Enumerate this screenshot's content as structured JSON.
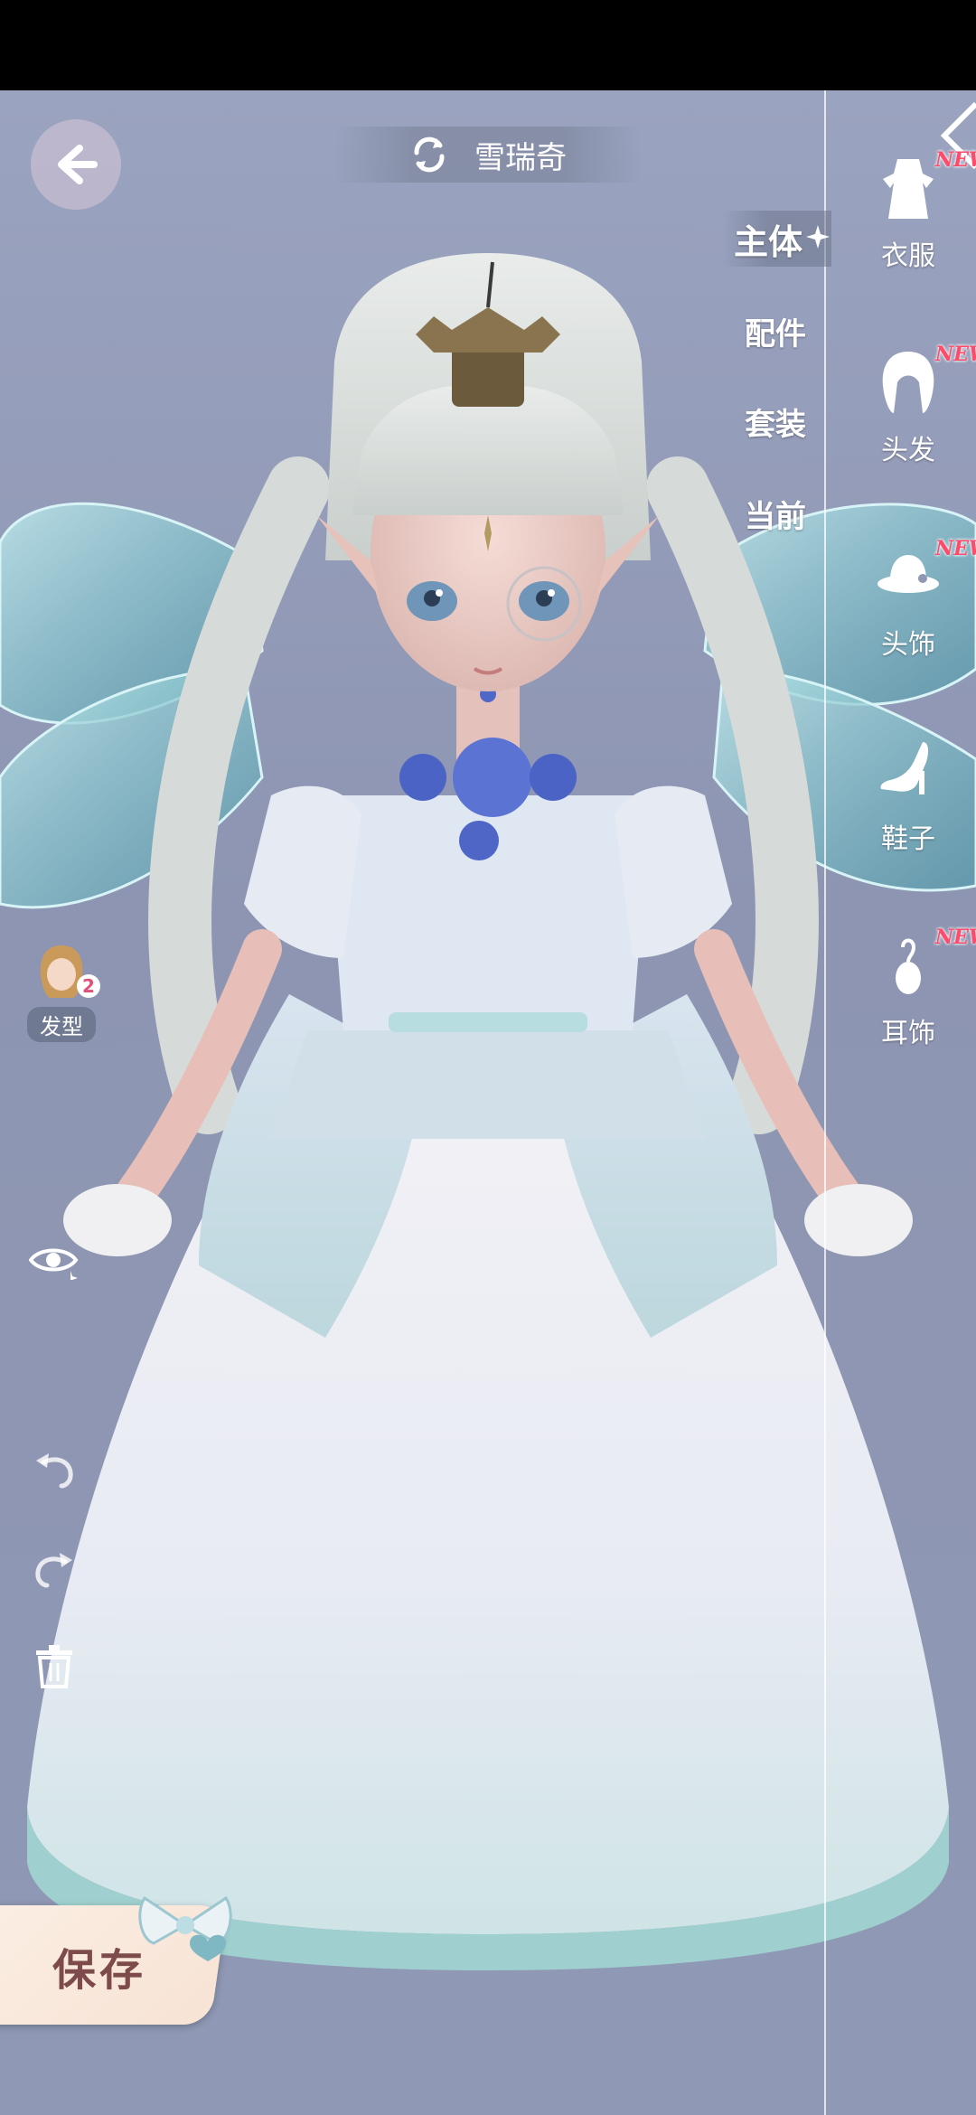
{
  "header": {
    "title": "雪瑞奇",
    "back_icon": "arrow-left-icon",
    "swap_icon": "refresh-icon"
  },
  "sub_tabs": [
    {
      "label": "主体",
      "active": true
    },
    {
      "label": "配件",
      "active": false
    },
    {
      "label": "套装",
      "active": false
    },
    {
      "label": "当前",
      "active": false
    }
  ],
  "categories": [
    {
      "label": "衣服",
      "icon": "dress-icon",
      "badge": "NEW"
    },
    {
      "label": "头发",
      "icon": "hair-icon",
      "badge": "NEW"
    },
    {
      "label": "头饰",
      "icon": "hat-icon",
      "badge": "NEW"
    },
    {
      "label": "鞋子",
      "icon": "shoe-icon",
      "badge": ""
    },
    {
      "label": "耳饰",
      "icon": "earring-icon",
      "badge": "NEW"
    }
  ],
  "left_tools": {
    "hair_type_label": "发型",
    "hair_type_count": "2",
    "tools": [
      "eye-icon",
      "undo-icon",
      "redo-icon",
      "trash-icon"
    ]
  },
  "save": {
    "label": "保存"
  },
  "colors": {
    "accent_new": "#ff4a6a",
    "background": "#8e97b3",
    "save_text": "#7d4b4b"
  }
}
